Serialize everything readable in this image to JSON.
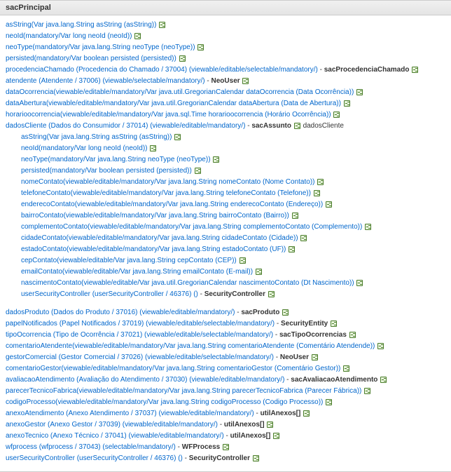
{
  "header": "sacPrincipal",
  "rows": [
    {
      "link": "asString(Var java.lang.String asString (asString))",
      "indent": 0
    },
    {
      "link": "neoId(mandatory/Var long neoId (neoId))",
      "indent": 0
    },
    {
      "link": "neoType(mandatory/Var java.lang.String neoType (neoType))",
      "indent": 0
    },
    {
      "link": "persisted(mandatory/Var boolean persisted (persisted))",
      "indent": 0
    },
    {
      "link": "procedenciaChamado (Procedencia do Chamado / 37004) (viewable/editable/selectable/mandatory/)",
      "bold": "sacProcedenciaChamado",
      "indent": 0,
      "extraIcon": true
    },
    {
      "link": "atendente (Atendente / 37006) (viewable/selectable/mandatory/)",
      "bold": "NeoUser",
      "indent": 0
    },
    {
      "link": "dataOcorrencia(viewable/editable/mandatory/Var java.util.GregorianCalendar dataOcorrencia (Data Ocorrência))",
      "indent": 0
    },
    {
      "link": "dataAbertura(viewable/editable/mandatory/Var java.util.GregorianCalendar dataAbertura (Data de Abertura))",
      "indent": 0
    },
    {
      "link": "horarioocorrencia(viewable/editable/mandatory/Var java.sql.Time horarioocorrencia (Horário Ocorrência))",
      "indent": 0
    },
    {
      "link": "dadosCliente (Dados do Consumidor / 37014) (viewable/editable/mandatory/)",
      "bold": "sacAssunto",
      "trail": "dadosCliente",
      "indent": 0,
      "extraIcon": true
    },
    {
      "link": "asString(Var java.lang.String asString (asString))",
      "indent": 1
    },
    {
      "link": "neoId(mandatory/Var long neoId (neoId))",
      "indent": 1
    },
    {
      "link": "neoType(mandatory/Var java.lang.String neoType (neoType))",
      "indent": 1
    },
    {
      "link": "persisted(mandatory/Var boolean persisted (persisted))",
      "indent": 1
    },
    {
      "link": "nomeContato(viewable/editable/mandatory/Var java.lang.String nomeContato (Nome Contato))",
      "indent": 1
    },
    {
      "link": "telefoneContato(viewable/editable/mandatory/Var java.lang.String telefoneContato (Telefone))",
      "indent": 1
    },
    {
      "link": "enderecoContato(viewable/editable/mandatory/Var java.lang.String enderecoContato (Endereço))",
      "indent": 1
    },
    {
      "link": "bairroContato(viewable/editable/mandatory/Var java.lang.String bairroContato (Bairro))",
      "indent": 1
    },
    {
      "link": "complementoContato(viewable/editable/mandatory/Var java.lang.String complementoContato (Complemento))",
      "indent": 1
    },
    {
      "link": "cidadeContato(viewable/editable/mandatory/Var java.lang.String cidadeContato (Cidade))",
      "indent": 1
    },
    {
      "link": "estadoContato(viewable/editable/mandatory/Var java.lang.String estadoContato (UF))",
      "indent": 1
    },
    {
      "link": "cepContato(viewable/editable/Var java.lang.String cepContato (CEP))",
      "indent": 1
    },
    {
      "link": "emailContato(viewable/editable/Var java.lang.String emailContato (E-mail))",
      "indent": 1
    },
    {
      "link": "nascimentoContato(viewable/editable/Var java.util.GregorianCalendar nascimentoContato (Dt Nascimento))",
      "indent": 1
    },
    {
      "link": "userSecurityController (userSecurityController / 46376) ()",
      "bold": "SecurityController",
      "indent": 1
    },
    {
      "spacer": true
    },
    {
      "link": "dadosProduto (Dados do Produto / 37016) (viewable/editable/mandatory/)",
      "bold": "sacProduto",
      "indent": 0,
      "extraIcon": true
    },
    {
      "link": "papelNotificados (Papel Notificados / 37019) (viewable/editable/selectable/mandatory/)",
      "bold": "SecurityEntity",
      "indent": 0
    },
    {
      "link": "tipoOcorrencia (Tipo de Ocorrência / 37021) (viewable/editable/selectable/mandatory/)",
      "bold": "sacTipoOcorrencias",
      "indent": 0,
      "extraIcon": true
    },
    {
      "link": "comentarioAtendente(viewable/editable/mandatory/Var java.lang.String comentarioAtendente (Comentário Atendende))",
      "indent": 0
    },
    {
      "link": "gestorComercial (Gestor Comercial / 37026) (viewable/editable/selectable/mandatory/)",
      "bold": "NeoUser",
      "indent": 0
    },
    {
      "link": "comentarioGestor(viewable/editable/mandatory/Var java.lang.String comentarioGestor (Comentário Gestor))",
      "indent": 0
    },
    {
      "link": "avaliacaoAtendimento (Avaliação do Atendimento / 37030) (viewable/editable/mandatory/)",
      "bold": "sacAvaliacaoAtendimento",
      "indent": 0,
      "extraIcon": true
    },
    {
      "link": "parecerTecnicoFabrica(viewable/editable/mandatory/Var java.lang.String parecerTecnicoFabrica (Parecer Fábrica))",
      "indent": 0
    },
    {
      "link": "codigoProcesso(viewable/editable/mandatory/Var java.lang.String codigoProcesso (Codigo Processo))",
      "indent": 0
    },
    {
      "link": "anexoAtendimento (Anexo Atendimento / 37037) (viewable/editable/mandatory/)",
      "bold": "utilAnexos[]",
      "indent": 0,
      "extraIcon": true
    },
    {
      "link": "anexoGestor (Anexo Gestor / 37039) (viewable/editable/mandatory/)",
      "bold": "utilAnexos[]",
      "indent": 0,
      "extraIcon": true
    },
    {
      "link": "anexoTecnico (Anexo Técnico / 37041) (viewable/editable/mandatory/)",
      "bold": "utilAnexos[]",
      "indent": 0,
      "extraIcon": true
    },
    {
      "link": "wfprocess (wfprocess / 37043) (selectable/mandatory/)",
      "bold": "WFProcess",
      "indent": 0
    },
    {
      "link": "userSecurityController (userSecurityController / 46376) ()",
      "bold": "SecurityController",
      "indent": 0
    }
  ]
}
